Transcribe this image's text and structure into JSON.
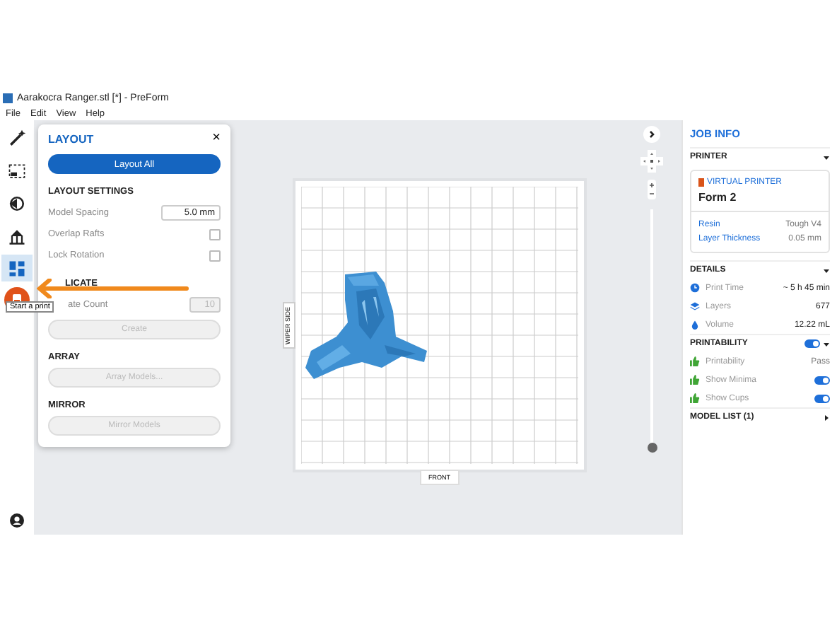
{
  "window": {
    "title": "Aarakocra Ranger.stl [*] - PreForm"
  },
  "menu": [
    "File",
    "Edit",
    "View",
    "Help"
  ],
  "toolbar": {
    "tools": [
      {
        "kind": "wand",
        "selected": false
      },
      {
        "kind": "select",
        "selected": false
      },
      {
        "kind": "orient",
        "selected": false
      },
      {
        "kind": "supports",
        "selected": false
      },
      {
        "kind": "layout",
        "selected": true
      }
    ],
    "print_button": {
      "tooltip": "Start a print"
    }
  },
  "layout_panel": {
    "title": "LAYOUT",
    "close": "×",
    "layout_all": "Layout All",
    "settings_heading": "LAYOUT SETTINGS",
    "model_spacing": {
      "label": "Model Spacing",
      "value": "5.0 mm"
    },
    "options": [
      {
        "label": "Overlap Rafts",
        "checked": false
      },
      {
        "label": "Lock Rotation",
        "checked": false
      }
    ],
    "duplicate": {
      "heading": "LICATE",
      "count_label": "ate Count",
      "count_value": "10",
      "button": {
        "label": "Create",
        "disabled": true
      }
    },
    "sections": [
      {
        "heading": "ARRAY",
        "button": {
          "label": "Array Models...",
          "disabled": true
        }
      },
      {
        "heading": "MIRROR",
        "button": {
          "label": "Mirror Models",
          "disabled": true
        }
      }
    ]
  },
  "canvas": {
    "side_label": "WIPER SIDE",
    "front_label": "FRONT",
    "zoom_slider": {
      "level": 0
    }
  },
  "job_info": {
    "title": "JOB INFO",
    "printer": {
      "heading": "PRINTER",
      "type": "VIRTUAL PRINTER",
      "name": "Form 2",
      "rows": [
        {
          "label": "Resin",
          "value": "Tough V4"
        },
        {
          "label": "Layer Thickness",
          "value": "0.05 mm"
        }
      ]
    },
    "details": {
      "heading": "DETAILS",
      "rows": [
        {
          "kind": "clock",
          "label": "Print Time",
          "value": "~ 5 h 45 min"
        },
        {
          "kind": "layers",
          "label": "Layers",
          "value": "677"
        },
        {
          "kind": "volume",
          "label": "Volume",
          "value": "12.22 mL"
        }
      ]
    },
    "printability": {
      "heading": "PRINTABILITY",
      "on": true,
      "rows": [
        {
          "label": "Printability",
          "kind": "text",
          "value": "Pass"
        },
        {
          "label": "Show Minima",
          "kind": "toggle",
          "on": true
        },
        {
          "label": "Show Cups",
          "kind": "toggle",
          "on": true
        }
      ]
    },
    "model_list": {
      "heading": "MODEL LIST (1)"
    }
  }
}
